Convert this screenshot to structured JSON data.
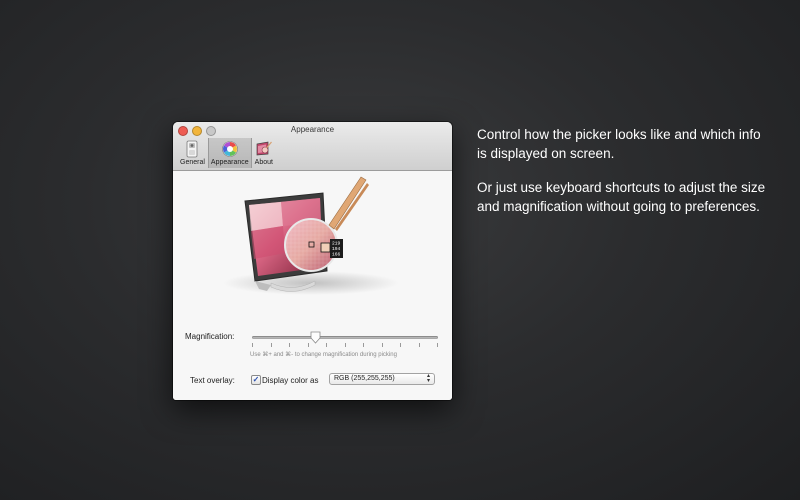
{
  "window": {
    "title": "Appearance",
    "toolbar": [
      {
        "label": "General",
        "icon": "general-switch-icon",
        "selected": false
      },
      {
        "label": "Appearance",
        "icon": "color-wheel-icon",
        "selected": true
      },
      {
        "label": "About",
        "icon": "picker-app-icon",
        "selected": false
      }
    ]
  },
  "illustration": {
    "readout": [
      "219",
      "194",
      "166"
    ]
  },
  "magnification": {
    "label": "Magnification:",
    "hint": "Use ⌘+ and ⌘- to change magnification during picking",
    "level": 0.33
  },
  "text_overlay": {
    "label": "Text overlay:",
    "checkbox_label": "Display color as",
    "checked": true,
    "selected_format": "RGB (255,255,255)"
  },
  "description": {
    "paragraph1": "Control how the picker looks like and which info is displayed on screen.",
    "paragraph2": "Or just use keyboard shortcuts to adjust the size and magnification without going to preferences."
  },
  "colors": {
    "background": "#2b2c2e",
    "window": "#ececec",
    "accent": "#c1466a"
  }
}
